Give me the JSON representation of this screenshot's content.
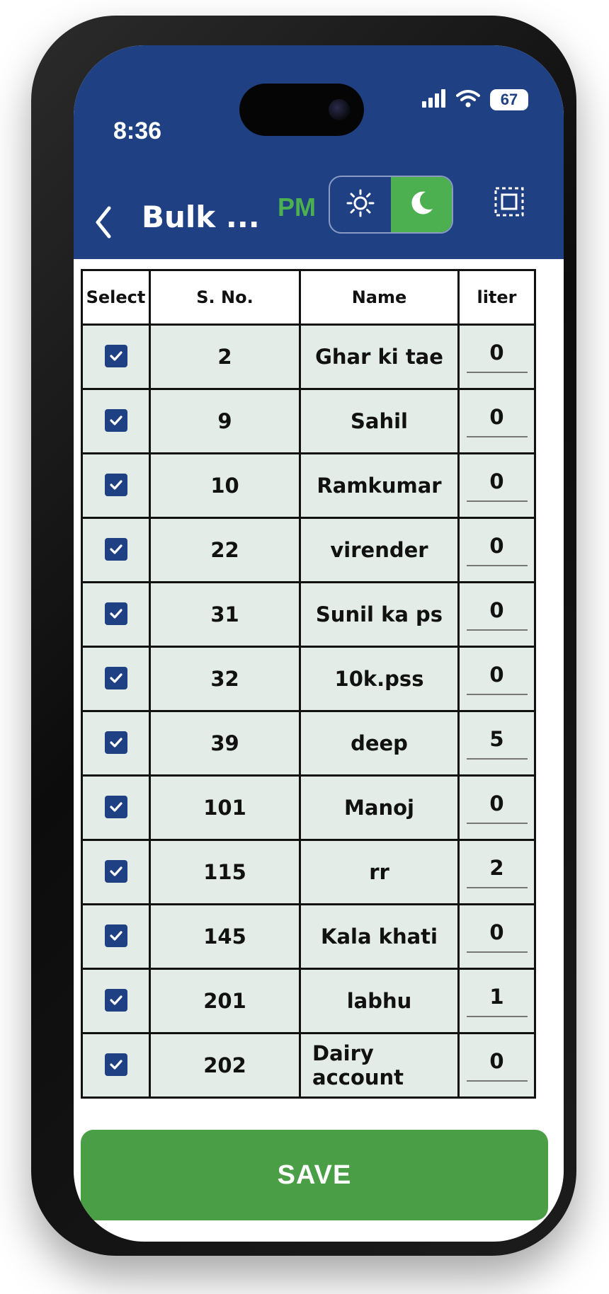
{
  "status_bar": {
    "time": "8:36",
    "battery": "67",
    "icons": [
      "signal-icon",
      "wifi-icon",
      "battery-icon"
    ]
  },
  "header": {
    "title": "Bulk ...",
    "session": "PM",
    "theme_toggle": {
      "options": [
        "light",
        "dark"
      ],
      "selected": "dark"
    }
  },
  "table": {
    "columns": [
      "Select",
      "S. No.",
      "Name",
      "liter"
    ],
    "rows": [
      {
        "checked": true,
        "sno": "2",
        "name": "Ghar ki tae",
        "liter": "0"
      },
      {
        "checked": true,
        "sno": "9",
        "name": "Sahil",
        "liter": "0"
      },
      {
        "checked": true,
        "sno": "10",
        "name": "Ramkumar",
        "liter": "0"
      },
      {
        "checked": true,
        "sno": "22",
        "name": "virender",
        "liter": "0"
      },
      {
        "checked": true,
        "sno": "31",
        "name": "Sunil ka ps",
        "liter": "0"
      },
      {
        "checked": true,
        "sno": "32",
        "name": "10k.pss",
        "liter": "0"
      },
      {
        "checked": true,
        "sno": "39",
        "name": "deep",
        "liter": "5"
      },
      {
        "checked": true,
        "sno": "101",
        "name": "Manoj",
        "liter": "0"
      },
      {
        "checked": true,
        "sno": "115",
        "name": "rr",
        "liter": "2"
      },
      {
        "checked": true,
        "sno": "145",
        "name": "Kala khati",
        "liter": "0"
      },
      {
        "checked": true,
        "sno": "201",
        "name": "labhu",
        "liter": "1"
      },
      {
        "checked": true,
        "sno": "202",
        "name": "Dairy account",
        "liter": "0"
      }
    ]
  },
  "footer": {
    "save_label": "SAVE"
  },
  "colors": {
    "header_bg": "#1f4184",
    "accent_green": "#4a9e45",
    "row_bg": "#e3ece6"
  }
}
